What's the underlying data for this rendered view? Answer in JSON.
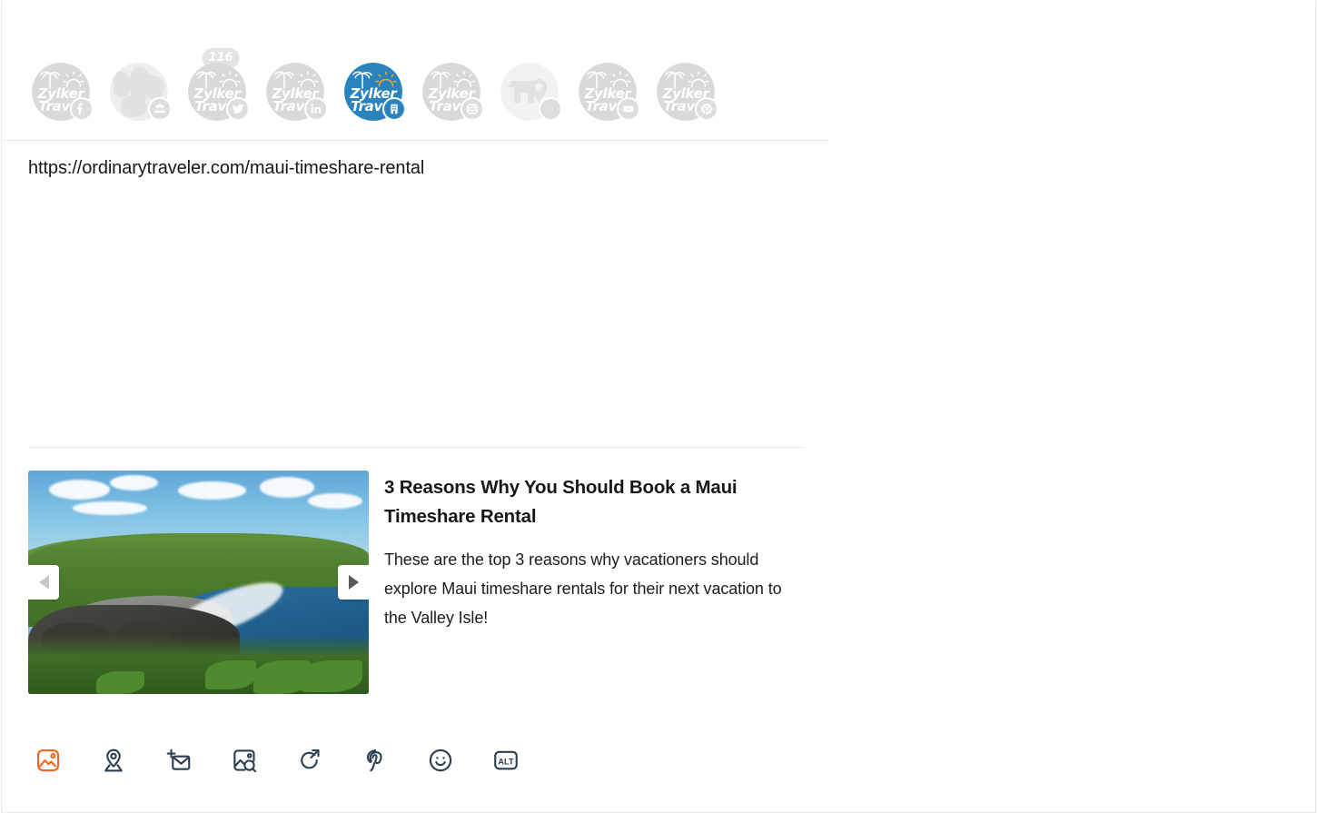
{
  "composer": {
    "post_url": "https://ordinarytraveler.com/maui-timeshare-rental"
  },
  "channels": [
    {
      "id": "facebook-page",
      "brand": "Zylker Travel",
      "logo_line1": "Zylker",
      "logo_line2": "Travel",
      "platform": "facebook",
      "badge_icon": "facebook-icon",
      "active": false,
      "avatar_type": "logo",
      "count": ""
    },
    {
      "id": "facebook-group",
      "brand": "Zylker Travel",
      "logo_line1": "",
      "logo_line2": "",
      "platform": "facebook-group",
      "badge_icon": "group-icon",
      "active": false,
      "avatar_type": "photo",
      "count": ""
    },
    {
      "id": "twitter",
      "brand": "Zylker Travel",
      "logo_line1": "Zylker",
      "logo_line2": "Travel",
      "platform": "twitter",
      "badge_icon": "twitter-icon",
      "active": false,
      "avatar_type": "logo",
      "count": "116"
    },
    {
      "id": "linkedin",
      "brand": "Zylker Travel",
      "logo_line1": "Zylker",
      "logo_line2": "Travel",
      "platform": "linkedin",
      "badge_icon": "linkedin-icon",
      "active": false,
      "avatar_type": "logo",
      "count": ""
    },
    {
      "id": "google-business",
      "brand": "Zylker Travel",
      "logo_line1": "Zylker",
      "logo_line2": "Travel",
      "platform": "gmb",
      "badge_icon": "building-icon",
      "active": true,
      "avatar_type": "logo",
      "count": ""
    },
    {
      "id": "instagram",
      "brand": "Zylker Travel",
      "logo_line1": "Zylker",
      "logo_line2": "Travel",
      "platform": "instagram",
      "badge_icon": "instagram-icon",
      "active": false,
      "avatar_type": "logo",
      "count": ""
    },
    {
      "id": "google-profile",
      "brand": "Zylker Travel",
      "logo_line1": "",
      "logo_line2": "",
      "platform": "google",
      "badge_icon": "google-g-icon",
      "active": false,
      "avatar_type": "store",
      "count": ""
    },
    {
      "id": "youtube",
      "brand": "Zylker Travel",
      "logo_line1": "Zylker",
      "logo_line2": "Travel",
      "platform": "youtube",
      "badge_icon": "youtube-icon",
      "active": false,
      "avatar_type": "logo",
      "count": ""
    },
    {
      "id": "pinterest",
      "brand": "Zylker Travel",
      "logo_line1": "Zylker",
      "logo_line2": "Travel",
      "platform": "pinterest",
      "badge_icon": "pinterest-icon",
      "active": false,
      "avatar_type": "logo",
      "count": ""
    }
  ],
  "link_preview": {
    "title": "3 Reasons Why You Should Book a Maui Timeshare Rental",
    "description": "These are the top 3 reasons why vacationers should explore Maui timeshare rentals for their next vacation to the Valley Isle!",
    "image_alt": "Maui black sand beach with green hills and blue ocean",
    "prev_enabled": false,
    "next_enabled": true
  },
  "toolbar": [
    {
      "id": "add-image",
      "icon": "image-icon",
      "active": true
    },
    {
      "id": "add-location",
      "icon": "location-pin-icon",
      "active": false
    },
    {
      "id": "add-invite",
      "icon": "envelope-add-icon",
      "active": false
    },
    {
      "id": "image-search",
      "icon": "image-search-icon",
      "active": false
    },
    {
      "id": "share-link",
      "icon": "share-arrow-icon",
      "active": false
    },
    {
      "id": "pinterest",
      "icon": "pinterest-icon",
      "active": false
    },
    {
      "id": "emoji",
      "icon": "smiley-icon",
      "active": false
    },
    {
      "id": "alt-text",
      "icon": "alt-text-icon",
      "active": false
    }
  ],
  "colors": {
    "accent_orange": "#f26722",
    "brand_blue": "#2a83bd",
    "icon_dark": "#2c3e50",
    "text_dark": "#15181b",
    "divider": "#e7e8ea"
  }
}
